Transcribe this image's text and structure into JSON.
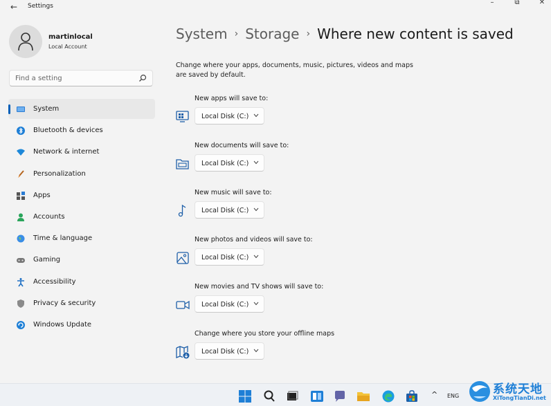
{
  "window": {
    "title": "Settings",
    "back_glyph": "←",
    "min_glyph": "–",
    "max_glyph": "⧉",
    "close_glyph": "✕"
  },
  "account": {
    "name": "martinlocal",
    "type": "Local Account",
    "icon": "person-icon"
  },
  "search": {
    "placeholder": "Find a setting",
    "icon": "search-icon"
  },
  "sidebar": {
    "accent": "#005fb8",
    "active_index": 0,
    "items": [
      {
        "label": "System",
        "icon": "system-icon"
      },
      {
        "label": "Bluetooth & devices",
        "icon": "bluetooth-icon"
      },
      {
        "label": "Network & internet",
        "icon": "wifi-icon"
      },
      {
        "label": "Personalization",
        "icon": "brush-icon"
      },
      {
        "label": "Apps",
        "icon": "apps-icon"
      },
      {
        "label": "Accounts",
        "icon": "accounts-icon"
      },
      {
        "label": "Time & language",
        "icon": "globe-icon"
      },
      {
        "label": "Gaming",
        "icon": "gamepad-icon"
      },
      {
        "label": "Accessibility",
        "icon": "accessibility-icon"
      },
      {
        "label": "Privacy & security",
        "icon": "shield-icon"
      },
      {
        "label": "Windows Update",
        "icon": "update-icon"
      }
    ]
  },
  "breadcrumb": {
    "items": [
      "System",
      "Storage"
    ],
    "separator": "›",
    "current": "Where new content is saved"
  },
  "description": "Change where your apps, documents, music, pictures, videos and maps are saved by default.",
  "save_locations": [
    {
      "label": "New apps will save to:",
      "value": "Local Disk (C:)",
      "icon": "apps-monitor-icon"
    },
    {
      "label": "New documents will save to:",
      "value": "Local Disk (C:)",
      "icon": "folder-icon"
    },
    {
      "label": "New music will save to:",
      "value": "Local Disk (C:)",
      "icon": "music-note-icon"
    },
    {
      "label": "New photos and videos will save to:",
      "value": "Local Disk (C:)",
      "icon": "picture-icon"
    },
    {
      "label": "New movies and TV shows will save to:",
      "value": "Local Disk (C:)",
      "icon": "video-camera-icon"
    },
    {
      "label": "Change where you store your offline maps",
      "value": "Local Disk (C:)",
      "icon": "map-download-icon"
    }
  ],
  "taskbar": {
    "icons": [
      "start-icon",
      "search-icon",
      "task-view-icon",
      "widgets-icon",
      "chat-icon",
      "file-explorer-icon",
      "edge-icon",
      "store-icon"
    ],
    "tray_chevron": "^",
    "language": "ENG"
  },
  "watermark": {
    "title": "系统天地",
    "url": "XiTongTianDi.net"
  }
}
